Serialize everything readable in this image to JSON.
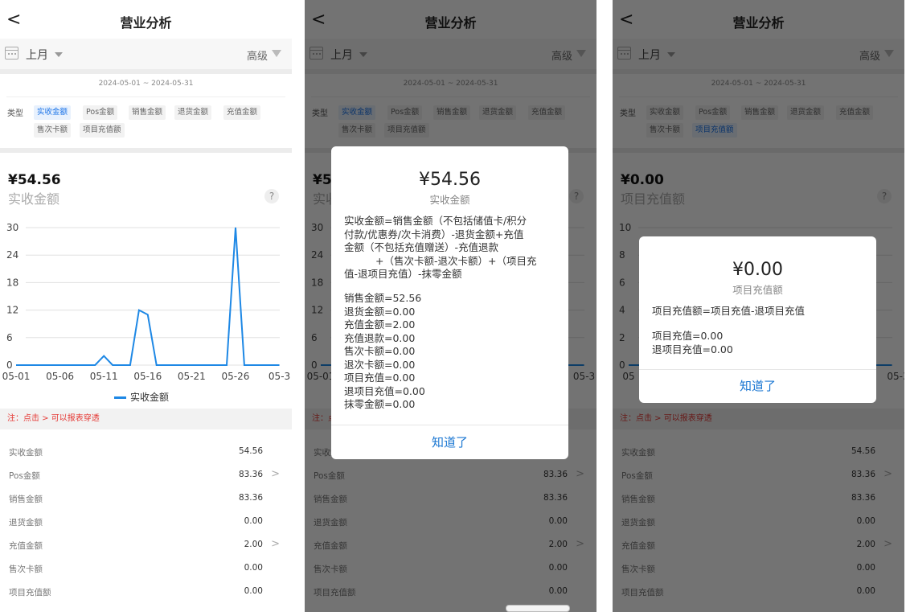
{
  "header": {
    "title": "营业分析",
    "back_glyph": "<"
  },
  "filter": {
    "period": "上月",
    "advanced": "高级"
  },
  "date_range": "2024-05-01 ~ 2024-05-31",
  "type_label": "类型",
  "type_chips": [
    "实收金额",
    "Pos金额",
    "销售金额",
    "退货金额",
    "充值金额",
    "售次卡额",
    "项目充值额"
  ],
  "screens": [
    {
      "selected_chip": 0,
      "amount": "¥54.56",
      "metric": "实收金额"
    },
    {
      "selected_chip": 0,
      "amount": "¥54.56",
      "metric": "实收金额"
    },
    {
      "selected_chip": 6,
      "amount": "¥0.00",
      "metric": "项目充值额"
    }
  ],
  "help_glyph": "?",
  "note": "注：点击 > 可以报表穿透",
  "summary_rows": [
    {
      "label": "实收金额",
      "value": "54.56",
      "drill": false
    },
    {
      "label": "Pos金额",
      "value": "83.36",
      "drill": true
    },
    {
      "label": "销售金额",
      "value": "83.36",
      "drill": false
    },
    {
      "label": "退货金额",
      "value": "0.00",
      "drill": false
    },
    {
      "label": "充值金额",
      "value": "2.00",
      "drill": true
    },
    {
      "label": "售次卡额",
      "value": "0.00",
      "drill": false
    },
    {
      "label": "项目充值额",
      "value": "0.00",
      "drill": false
    }
  ],
  "chart_data": [
    {
      "type": "line",
      "x_ticks": [
        "05-01",
        "05-06",
        "05-11",
        "05-16",
        "05-21",
        "05-26",
        "05-3"
      ],
      "y_ticks": [
        0,
        6,
        12,
        18,
        24,
        30
      ],
      "ylim": [
        0,
        30
      ],
      "series": [
        {
          "name": "实收金额",
          "color": "#1e88e5",
          "points": [
            [
              "05-01",
              0
            ],
            [
              "05-10",
              0
            ],
            [
              "05-11",
              2
            ],
            [
              "05-12",
              0
            ],
            [
              "05-14",
              0
            ],
            [
              "05-15",
              12
            ],
            [
              "05-16",
              11
            ],
            [
              "05-17",
              0
            ],
            [
              "05-25",
              0
            ],
            [
              "05-26",
              30
            ],
            [
              "05-27",
              0
            ],
            [
              "05-31",
              0
            ]
          ]
        }
      ]
    },
    {
      "type": "line",
      "y_ticks": [
        0,
        2,
        4,
        6,
        8,
        10
      ],
      "x_ticks": [
        "05",
        "05-3"
      ],
      "ylim": [
        0,
        10
      ],
      "series": [
        {
          "name": "项目充值额",
          "color": "#1e88e5",
          "points": [
            [
              "05-01",
              0
            ],
            [
              "05-31",
              0
            ]
          ]
        }
      ]
    }
  ],
  "modal_revenue": {
    "amount": "¥54.56",
    "subtitle": "实收金额",
    "formula_lines": [
      "实收金额=销售金额（不包括储值卡/积分",
      "付款/优惠券/次卡消费）-退货金额+充值",
      "金额（不包括充值赠送）-充值退款",
      "+（售次卡额-退次卡额）+（项目充",
      "值-退项目充值）-抹零金额"
    ],
    "breakdown": [
      "销售金额=52.56",
      "退货金额=0.00",
      "充值金额=2.00",
      "充值退款=0.00",
      "售次卡额=0.00",
      "退次卡额=0.00",
      "项目充值=0.00",
      "退项目充值=0.00",
      "抹零金额=0.00"
    ],
    "button": "知道了"
  },
  "modal_project": {
    "amount": "¥0.00",
    "subtitle": "项目充值额",
    "formula": "项目充值额=项目充值-退项目充值",
    "breakdown": [
      "项目充值=0.00",
      "退项目充值=0.00"
    ],
    "button": "知道了"
  }
}
